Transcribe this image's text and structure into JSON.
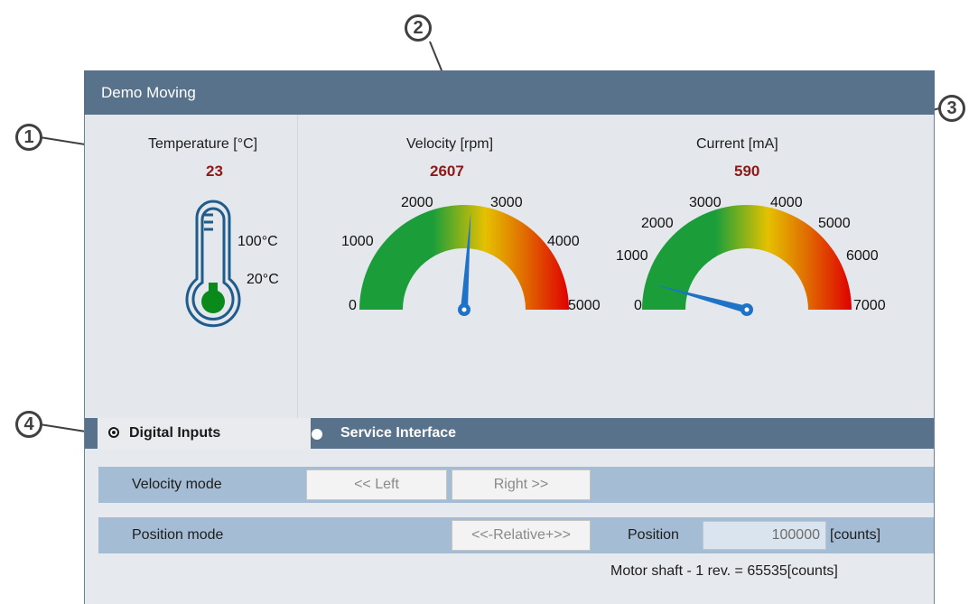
{
  "window": {
    "title": "Demo Moving"
  },
  "callouts": [
    "1",
    "2",
    "3",
    "4"
  ],
  "gauges": {
    "temperature": {
      "title": "Temperature [°C]",
      "value": "23",
      "scale_high": "100°C",
      "scale_low": "20°C",
      "level_fraction": 0.04
    },
    "velocity": {
      "title": "Velocity [rpm]",
      "value": "2607",
      "ticks": [
        "0",
        "1000",
        "2000",
        "3000",
        "4000",
        "5000"
      ],
      "min": 0,
      "max": 5000,
      "reading": 2607
    },
    "current": {
      "title": "Current [mA]",
      "value": "590",
      "ticks": [
        "0",
        "1000",
        "2000",
        "3000",
        "4000",
        "5000",
        "6000",
        "7000"
      ],
      "min": 0,
      "max": 7000,
      "reading": 590
    }
  },
  "tabs": [
    {
      "label": "Digital Inputs",
      "selected": true
    },
    {
      "label": "Service Interface",
      "selected": false
    }
  ],
  "velocity_mode": {
    "label": "Velocity mode",
    "left_button": "<< Left",
    "right_button": "Right >>"
  },
  "position_mode": {
    "label": "Position mode",
    "relative_button": "<<-Relative+>>",
    "position_label": "Position",
    "position_value": "100000",
    "unit": "[counts]"
  },
  "footer_note": "Motor shaft - 1 rev. = 65535[counts]",
  "colors": {
    "titlebar": "#58728c",
    "row": "#a4bdd4",
    "needle": "#1f73c6",
    "value_text": "#8b1a1a",
    "gauge_low": "#1b9e3a",
    "gauge_mid": "#e5c100",
    "gauge_high": "#e00000"
  }
}
